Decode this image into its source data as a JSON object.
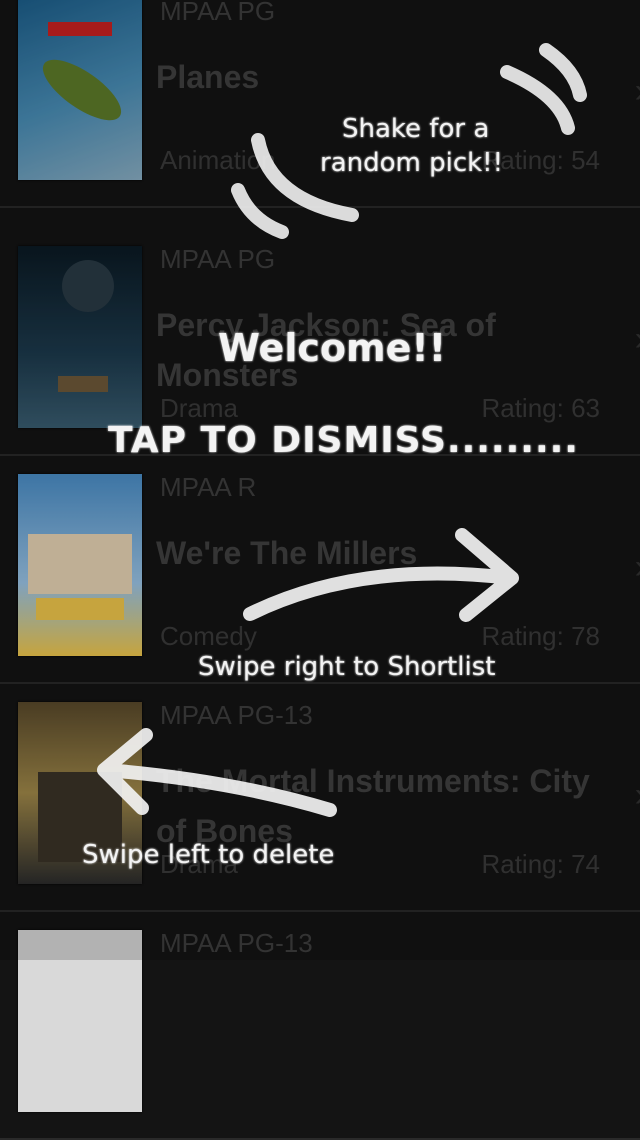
{
  "movies": [
    {
      "mpaa": "MPAA PG",
      "title": "Planes",
      "genre": "Animation",
      "rating": "Rating: 54",
      "poster_colors": [
        "#1c5f8c",
        "#4a8fb8",
        "#8bb0c6"
      ]
    },
    {
      "mpaa": "MPAA PG",
      "title": "Percy Jackson: Sea of Monsters",
      "genre": "Drama",
      "rating": "Rating: 63",
      "poster_colors": [
        "#0b1a24",
        "#1d3b4e",
        "#3a5e72"
      ]
    },
    {
      "mpaa": "MPAA R",
      "title": "We're The Millers",
      "genre": "Comedy",
      "rating": "Rating: 78",
      "poster_colors": [
        "#4b8fc9",
        "#f2c94c",
        "#c33"
      ]
    },
    {
      "mpaa": "MPAA PG-13",
      "title": "The Mortal Instruments: City of Bones",
      "genre": "Drama",
      "rating": "Rating: 74",
      "poster_colors": [
        "#5a4a2b",
        "#a28a4a",
        "#2d2d2d"
      ]
    },
    {
      "mpaa": "MPAA PG-13",
      "title": "",
      "genre": "",
      "rating": "",
      "poster_colors": [
        "#d9d9d9",
        "#aaaaaa",
        "#444444"
      ]
    }
  ],
  "coach": {
    "shake_line1": "Shake for a",
    "shake_line2": "random pick!!",
    "welcome": "Welcome!!",
    "dismiss": "TAP TO DISMISS.........",
    "swipe_right": "Swipe right to Shortlist",
    "swipe_left": "Swipe left to delete"
  }
}
